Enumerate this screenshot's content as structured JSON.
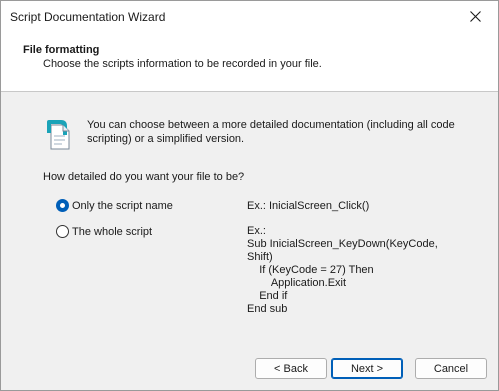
{
  "window": {
    "title": "Script Documentation Wizard"
  },
  "header": {
    "title": "File formatting",
    "subtitle": "Choose the scripts information to be recorded in your file."
  },
  "info": {
    "text": "You can choose between a more detailed documentation (including all code scripting) or a simplified version."
  },
  "question": "How detailed do you want your file to be?",
  "options": [
    {
      "label": "Only the script name",
      "checked": true,
      "example": "Ex.: InicialScreen_Click()"
    },
    {
      "label": "The whole script",
      "checked": false,
      "example": "Ex.:\nSub InicialScreen_KeyDown(KeyCode,\nShift)\n    If (KeyCode = 27) Then\n        Application.Exit\n    End if\nEnd sub"
    }
  ],
  "buttons": {
    "back": "< Back",
    "next": "Next >",
    "cancel": "Cancel"
  }
}
